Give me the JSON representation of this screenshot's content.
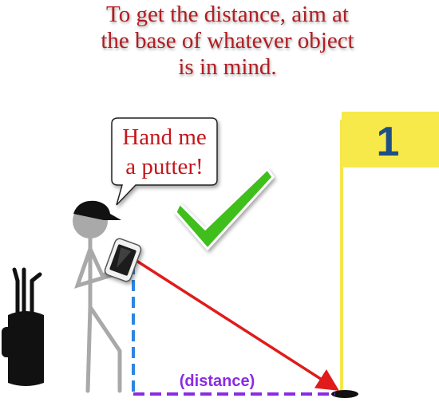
{
  "caption": {
    "lines": [
      "To get the distance, aim at",
      "the base of whatever object",
      "is in mind."
    ]
  },
  "speech_bubble": {
    "lines": [
      "Hand me",
      "a putter!"
    ]
  },
  "flag": {
    "number": "1",
    "flag_color": "#f7e94a",
    "pole_color": "#f5e64d"
  },
  "measure": {
    "distance_label": "(distance)",
    "aim_line_color": "#e01b1b",
    "height_line_color": "#2e86de",
    "distance_line_color": "#8a2be2"
  },
  "icons": {
    "checkmark": "checkmark-icon",
    "phone": "phone-icon",
    "golf_bag": "golf-bag-icon"
  },
  "colors": {
    "caption": "#b01e24",
    "checkmark": "#3fbf1f",
    "stick_figure": "#a9a9a9"
  }
}
